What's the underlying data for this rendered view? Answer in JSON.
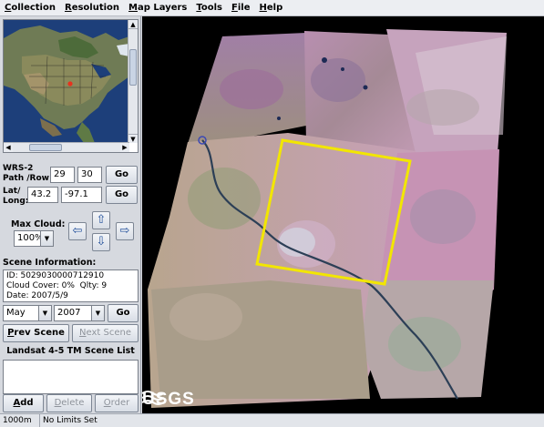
{
  "menubar": {
    "items": [
      {
        "mnemonic": "C",
        "rest": "ollection"
      },
      {
        "mnemonic": "R",
        "rest": "esolution"
      },
      {
        "mnemonic": "M",
        "rest": "ap Layers"
      },
      {
        "mnemonic": "T",
        "rest": "ools"
      },
      {
        "mnemonic": "F",
        "rest": "ile"
      },
      {
        "mnemonic": "H",
        "rest": "elp"
      }
    ]
  },
  "wrs": {
    "label_line1": "WRS-2",
    "label_line2": "Path /Row:",
    "path": "29",
    "row": "30",
    "go_label": "Go"
  },
  "latlong": {
    "label_line1": "Lat/",
    "label_line2": "Long:",
    "lat": "43.2",
    "long": "-97.1",
    "go_label": "Go"
  },
  "cloud": {
    "label": "Max Cloud:",
    "value": "100%"
  },
  "nav_arrows": {
    "up": "⇧",
    "down": "⇩",
    "left": "⇦",
    "right": "⇨"
  },
  "scene_info": {
    "label": "Scene Information:",
    "id_line": "ID: 5029030000712910",
    "cloud_cover": "Cloud Cover: 0%",
    "quality": "Qlty: 9",
    "date_line": "Date: 2007/5/9"
  },
  "date_select": {
    "month": "May",
    "year": "2007",
    "go_label": "Go"
  },
  "scene_nav": {
    "prev_mnemonic": "P",
    "prev_rest": "rev Scene",
    "next_mnemonic": "N",
    "next_rest": "ext Scene"
  },
  "scene_list": {
    "title": "Landsat 4-5 TM Scene List",
    "items": []
  },
  "list_buttons": {
    "add_mnemonic": "A",
    "add_rest": "dd",
    "delete_mnemonic": "D",
    "delete_rest": "elete",
    "order_mnemonic": "O",
    "order_rest": "rder"
  },
  "map": {
    "logo_text": "USGS",
    "selection_color": "#f2e600",
    "background_color": "#000000"
  },
  "statusbar": {
    "scale": "1000m",
    "limits": "No Limits Set"
  },
  "icons": {
    "scroll_up": "▲",
    "scroll_down": "▼",
    "scroll_left": "◀",
    "scroll_right": "▶",
    "dropdown": "▼"
  }
}
